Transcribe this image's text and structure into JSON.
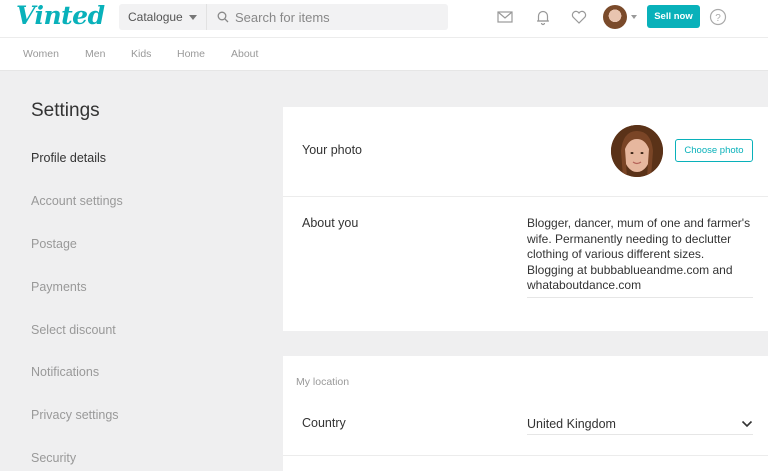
{
  "header": {
    "logo": "Vinted",
    "catalogue_label": "Catalogue",
    "search_placeholder": "Search for items",
    "sell_label": "Sell now"
  },
  "catnav": [
    "Women",
    "Men",
    "Kids",
    "Home",
    "About"
  ],
  "sidebar": {
    "title": "Settings",
    "items": [
      {
        "label": "Profile details",
        "active": true
      },
      {
        "label": "Account settings"
      },
      {
        "label": "Postage"
      },
      {
        "label": "Payments"
      },
      {
        "label": "Select discount"
      },
      {
        "label": "Notifications"
      },
      {
        "label": "Privacy settings"
      },
      {
        "label": "Security"
      }
    ]
  },
  "profile": {
    "photo_label": "Your photo",
    "choose_photo_label": "Choose photo",
    "about_label": "About you",
    "about_text": "Blogger, dancer, mum of one and farmer's wife. Permanently needing to declutter clothing of various different sizes. Blogging at bubbablueandme.com and whataboutdance.com"
  },
  "location": {
    "heading": "My location",
    "country_label": "Country",
    "country_value": "United Kingdom"
  },
  "colors": {
    "accent": "#09b1ba",
    "background": "#efeff0"
  },
  "icons": {
    "messages": "envelope-icon",
    "notifications": "bell-icon",
    "favourites": "heart-icon",
    "help": "question-circle-icon",
    "search": "search-icon",
    "dropdown": "chevron-down-icon"
  }
}
